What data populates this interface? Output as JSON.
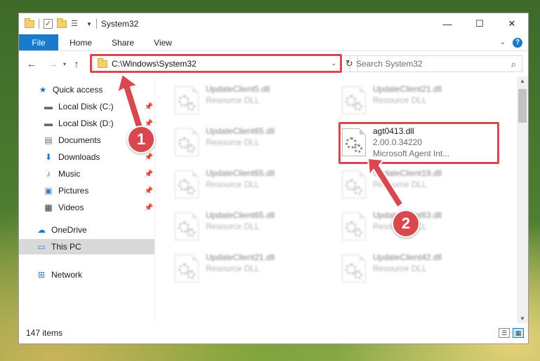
{
  "window": {
    "title": "System32",
    "controls": [
      "minimize",
      "maximize",
      "close"
    ]
  },
  "ribbon": {
    "tabs": [
      "File",
      "Home",
      "Share",
      "View"
    ],
    "help": "?"
  },
  "nav": {
    "address": "C:\\Windows\\System32",
    "search_placeholder": "Search System32"
  },
  "sidebar": {
    "items": [
      {
        "label": "Quick access",
        "icon": "star-icon"
      },
      {
        "label": "Local Disk (C:)",
        "icon": "drive-icon",
        "pinned": true
      },
      {
        "label": "Local Disk (D:)",
        "icon": "drive-icon",
        "pinned": true
      },
      {
        "label": "Documents",
        "icon": "documents-icon",
        "pinned": true
      },
      {
        "label": "Downloads",
        "icon": "download-icon",
        "pinned": true
      },
      {
        "label": "Music",
        "icon": "music-icon",
        "pinned": true
      },
      {
        "label": "Pictures",
        "icon": "pictures-icon",
        "pinned": true
      },
      {
        "label": "Videos",
        "icon": "videos-icon",
        "pinned": true
      },
      {
        "label": "OneDrive",
        "icon": "cloud-icon"
      },
      {
        "label": "This PC",
        "icon": "computer-icon",
        "selected": true
      },
      {
        "label": "Network",
        "icon": "network-icon"
      }
    ]
  },
  "files": [
    {
      "name": "UpdateClient5.dll",
      "line2": "Resource DLL",
      "blurred": true
    },
    {
      "name": "UpdateClient21.dll",
      "line2": "Resource DLL",
      "blurred": true
    },
    {
      "name": "UpdateClient65.dll",
      "line2": "Resource DLL",
      "blurred": true
    },
    {
      "name": "agt0413.dll",
      "line2": "2.00.0.34220",
      "line3": "Microsoft Agent Int...",
      "blurred": false
    },
    {
      "name": "UpdateClient65.dll",
      "line2": "Resource DLL",
      "blurred": true
    },
    {
      "name": "UpdateClient19.dll",
      "line2": "Resource DLL",
      "blurred": true
    },
    {
      "name": "UpdateClient65.dll",
      "line2": "Resource DLL",
      "blurred": true
    },
    {
      "name": "UpdateClient63.dll",
      "line2": "Resource DLL",
      "blurred": true
    },
    {
      "name": "UpdateClient21.dll",
      "line2": "Resource DLL",
      "blurred": true
    },
    {
      "name": "UpdateClient42.dll",
      "line2": "Resource DLL",
      "blurred": true
    }
  ],
  "status": {
    "count": "147 items"
  },
  "annotations": {
    "step1": "1",
    "step2": "2",
    "color": "#d9484f"
  }
}
